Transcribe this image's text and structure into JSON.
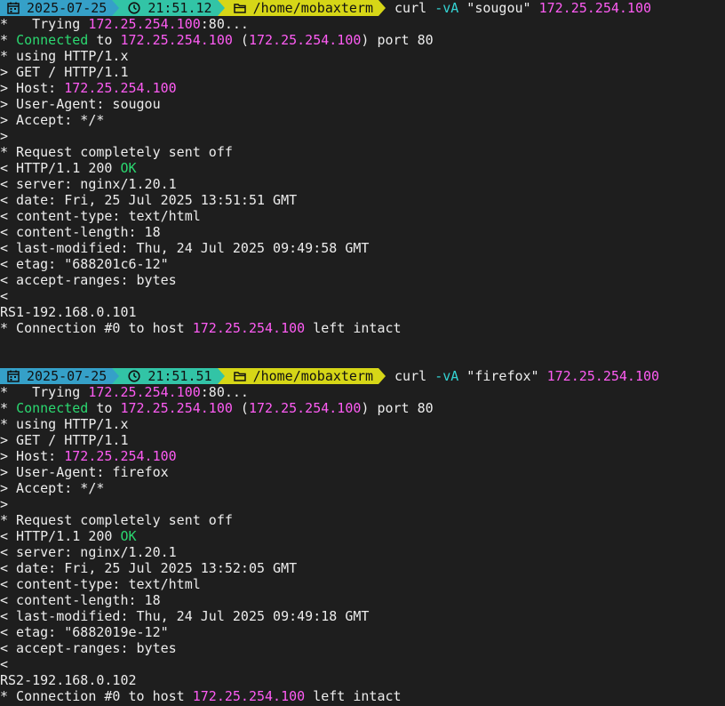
{
  "blocks": [
    {
      "prompt": {
        "date": "2025-07-25",
        "time": "21:51.12",
        "path": "/home/mobaxterm",
        "cmd": "curl",
        "flag": "-vA",
        "agent_arg": "\"sougou\"",
        "host": "172.25.254.100"
      },
      "lines": [
        [
          {
            "t": "*   Trying "
          },
          {
            "t": "172.25.254.100",
            "c": "magenta"
          },
          {
            "t": ":80..."
          }
        ],
        [
          {
            "t": "* "
          },
          {
            "t": "Connected",
            "c": "green"
          },
          {
            "t": " to "
          },
          {
            "t": "172.25.254.100",
            "c": "magenta"
          },
          {
            "t": " ("
          },
          {
            "t": "172.25.254.100",
            "c": "magenta"
          },
          {
            "t": ") port 80"
          }
        ],
        [
          {
            "t": "* using HTTP/1.x"
          }
        ],
        [
          {
            "t": "> GET / HTTP/1.1"
          }
        ],
        [
          {
            "t": "> Host: "
          },
          {
            "t": "172.25.254.100",
            "c": "magenta"
          }
        ],
        [
          {
            "t": "> User-Agent: sougou"
          }
        ],
        [
          {
            "t": "> Accept: */*"
          }
        ],
        [
          {
            "t": ">"
          }
        ],
        [
          {
            "t": "* Request completely sent off"
          }
        ],
        [
          {
            "t": "< HTTP/1.1 200 "
          },
          {
            "t": "OK",
            "c": "green"
          }
        ],
        [
          {
            "t": "< server: nginx/1.20.1"
          }
        ],
        [
          {
            "t": "< date: Fri, 25 Jul 2025 13:51:51 GMT"
          }
        ],
        [
          {
            "t": "< content-type: text/html"
          }
        ],
        [
          {
            "t": "< content-length: 18"
          }
        ],
        [
          {
            "t": "< last-modified: Thu, 24 Jul 2025 09:49:58 GMT"
          }
        ],
        [
          {
            "t": "< etag: \"688201c6-12\""
          }
        ],
        [
          {
            "t": "< accept-ranges: bytes"
          }
        ],
        [
          {
            "t": "<"
          }
        ],
        [
          {
            "t": "RS1-192.168.0.101"
          }
        ],
        [
          {
            "t": "* Connection #0 to host "
          },
          {
            "t": "172.25.254.100",
            "c": "magenta"
          },
          {
            "t": " left intact"
          }
        ]
      ]
    },
    {
      "prompt": {
        "date": "2025-07-25",
        "time": "21:51.51",
        "path": "/home/mobaxterm",
        "cmd": "curl",
        "flag": "-vA",
        "agent_arg": "\"firefox\"",
        "host": "172.25.254.100"
      },
      "lines": [
        [
          {
            "t": "*   Trying "
          },
          {
            "t": "172.25.254.100",
            "c": "magenta"
          },
          {
            "t": ":80..."
          }
        ],
        [
          {
            "t": "* "
          },
          {
            "t": "Connected",
            "c": "green"
          },
          {
            "t": " to "
          },
          {
            "t": "172.25.254.100",
            "c": "magenta"
          },
          {
            "t": " ("
          },
          {
            "t": "172.25.254.100",
            "c": "magenta"
          },
          {
            "t": ") port 80"
          }
        ],
        [
          {
            "t": "* using HTTP/1.x"
          }
        ],
        [
          {
            "t": "> GET / HTTP/1.1"
          }
        ],
        [
          {
            "t": "> Host: "
          },
          {
            "t": "172.25.254.100",
            "c": "magenta"
          }
        ],
        [
          {
            "t": "> User-Agent: firefox"
          }
        ],
        [
          {
            "t": "> Accept: */*"
          }
        ],
        [
          {
            "t": ">"
          }
        ],
        [
          {
            "t": "* Request completely sent off"
          }
        ],
        [
          {
            "t": "< HTTP/1.1 200 "
          },
          {
            "t": "OK",
            "c": "green"
          }
        ],
        [
          {
            "t": "< server: nginx/1.20.1"
          }
        ],
        [
          {
            "t": "< date: Fri, 25 Jul 2025 13:52:05 GMT"
          }
        ],
        [
          {
            "t": "< content-type: text/html"
          }
        ],
        [
          {
            "t": "< content-length: 18"
          }
        ],
        [
          {
            "t": "< last-modified: Thu, 24 Jul 2025 09:49:18 GMT"
          }
        ],
        [
          {
            "t": "< etag: \"6882019e-12\""
          }
        ],
        [
          {
            "t": "< accept-ranges: bytes"
          }
        ],
        [
          {
            "t": "<"
          }
        ],
        [
          {
            "t": "RS2-192.168.0.102"
          }
        ],
        [
          {
            "t": "* Connection #0 to host "
          },
          {
            "t": "172.25.254.100",
            "c": "magenta"
          },
          {
            "t": " left intact"
          }
        ]
      ]
    }
  ],
  "icons": {
    "date": "calendar-icon",
    "time": "clock-icon",
    "path": "folder-icon"
  },
  "colors": {
    "background": "#1e1e1e",
    "text": "#ececec",
    "ip": "#ff5cf4",
    "ok": "#2bd870",
    "flag": "#34d3d3",
    "prompt_date_bg": "#35a0c8",
    "prompt_time_bg": "#32c4a6",
    "prompt_path_bg": "#d6d617"
  }
}
